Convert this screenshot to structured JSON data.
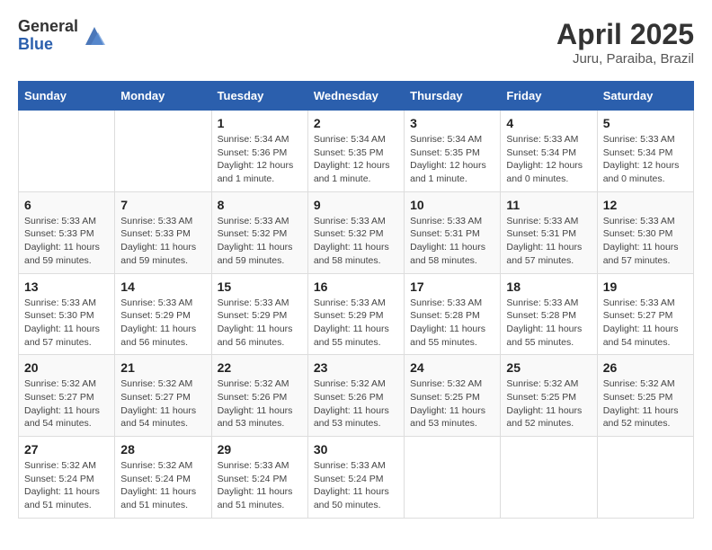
{
  "header": {
    "logo_general": "General",
    "logo_blue": "Blue",
    "month_title": "April 2025",
    "location": "Juru, Paraiba, Brazil"
  },
  "weekdays": [
    "Sunday",
    "Monday",
    "Tuesday",
    "Wednesday",
    "Thursday",
    "Friday",
    "Saturday"
  ],
  "weeks": [
    [
      {
        "day": "",
        "info": ""
      },
      {
        "day": "",
        "info": ""
      },
      {
        "day": "1",
        "info": "Sunrise: 5:34 AM\nSunset: 5:36 PM\nDaylight: 12 hours and 1 minute."
      },
      {
        "day": "2",
        "info": "Sunrise: 5:34 AM\nSunset: 5:35 PM\nDaylight: 12 hours and 1 minute."
      },
      {
        "day": "3",
        "info": "Sunrise: 5:34 AM\nSunset: 5:35 PM\nDaylight: 12 hours and 1 minute."
      },
      {
        "day": "4",
        "info": "Sunrise: 5:33 AM\nSunset: 5:34 PM\nDaylight: 12 hours and 0 minutes."
      },
      {
        "day": "5",
        "info": "Sunrise: 5:33 AM\nSunset: 5:34 PM\nDaylight: 12 hours and 0 minutes."
      }
    ],
    [
      {
        "day": "6",
        "info": "Sunrise: 5:33 AM\nSunset: 5:33 PM\nDaylight: 11 hours and 59 minutes."
      },
      {
        "day": "7",
        "info": "Sunrise: 5:33 AM\nSunset: 5:33 PM\nDaylight: 11 hours and 59 minutes."
      },
      {
        "day": "8",
        "info": "Sunrise: 5:33 AM\nSunset: 5:32 PM\nDaylight: 11 hours and 59 minutes."
      },
      {
        "day": "9",
        "info": "Sunrise: 5:33 AM\nSunset: 5:32 PM\nDaylight: 11 hours and 58 minutes."
      },
      {
        "day": "10",
        "info": "Sunrise: 5:33 AM\nSunset: 5:31 PM\nDaylight: 11 hours and 58 minutes."
      },
      {
        "day": "11",
        "info": "Sunrise: 5:33 AM\nSunset: 5:31 PM\nDaylight: 11 hours and 57 minutes."
      },
      {
        "day": "12",
        "info": "Sunrise: 5:33 AM\nSunset: 5:30 PM\nDaylight: 11 hours and 57 minutes."
      }
    ],
    [
      {
        "day": "13",
        "info": "Sunrise: 5:33 AM\nSunset: 5:30 PM\nDaylight: 11 hours and 57 minutes."
      },
      {
        "day": "14",
        "info": "Sunrise: 5:33 AM\nSunset: 5:29 PM\nDaylight: 11 hours and 56 minutes."
      },
      {
        "day": "15",
        "info": "Sunrise: 5:33 AM\nSunset: 5:29 PM\nDaylight: 11 hours and 56 minutes."
      },
      {
        "day": "16",
        "info": "Sunrise: 5:33 AM\nSunset: 5:29 PM\nDaylight: 11 hours and 55 minutes."
      },
      {
        "day": "17",
        "info": "Sunrise: 5:33 AM\nSunset: 5:28 PM\nDaylight: 11 hours and 55 minutes."
      },
      {
        "day": "18",
        "info": "Sunrise: 5:33 AM\nSunset: 5:28 PM\nDaylight: 11 hours and 55 minutes."
      },
      {
        "day": "19",
        "info": "Sunrise: 5:33 AM\nSunset: 5:27 PM\nDaylight: 11 hours and 54 minutes."
      }
    ],
    [
      {
        "day": "20",
        "info": "Sunrise: 5:32 AM\nSunset: 5:27 PM\nDaylight: 11 hours and 54 minutes."
      },
      {
        "day": "21",
        "info": "Sunrise: 5:32 AM\nSunset: 5:27 PM\nDaylight: 11 hours and 54 minutes."
      },
      {
        "day": "22",
        "info": "Sunrise: 5:32 AM\nSunset: 5:26 PM\nDaylight: 11 hours and 53 minutes."
      },
      {
        "day": "23",
        "info": "Sunrise: 5:32 AM\nSunset: 5:26 PM\nDaylight: 11 hours and 53 minutes."
      },
      {
        "day": "24",
        "info": "Sunrise: 5:32 AM\nSunset: 5:25 PM\nDaylight: 11 hours and 53 minutes."
      },
      {
        "day": "25",
        "info": "Sunrise: 5:32 AM\nSunset: 5:25 PM\nDaylight: 11 hours and 52 minutes."
      },
      {
        "day": "26",
        "info": "Sunrise: 5:32 AM\nSunset: 5:25 PM\nDaylight: 11 hours and 52 minutes."
      }
    ],
    [
      {
        "day": "27",
        "info": "Sunrise: 5:32 AM\nSunset: 5:24 PM\nDaylight: 11 hours and 51 minutes."
      },
      {
        "day": "28",
        "info": "Sunrise: 5:32 AM\nSunset: 5:24 PM\nDaylight: 11 hours and 51 minutes."
      },
      {
        "day": "29",
        "info": "Sunrise: 5:33 AM\nSunset: 5:24 PM\nDaylight: 11 hours and 51 minutes."
      },
      {
        "day": "30",
        "info": "Sunrise: 5:33 AM\nSunset: 5:24 PM\nDaylight: 11 hours and 50 minutes."
      },
      {
        "day": "",
        "info": ""
      },
      {
        "day": "",
        "info": ""
      },
      {
        "day": "",
        "info": ""
      }
    ]
  ]
}
